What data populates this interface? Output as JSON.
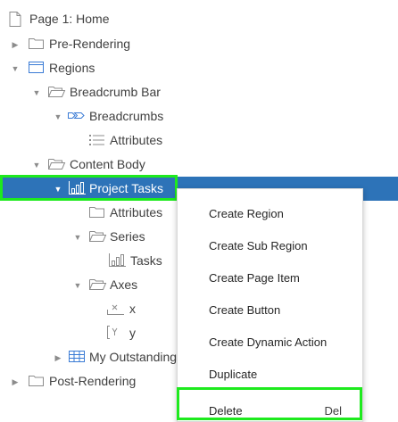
{
  "tree": {
    "page": "Page 1: Home",
    "pre_rendering": "Pre-Rendering",
    "regions": "Regions",
    "breadcrumb_bar": "Breadcrumb Bar",
    "breadcrumbs": "Breadcrumbs",
    "attributes_1": "Attributes",
    "content_body": "Content Body",
    "project_tasks": "Project Tasks",
    "attributes_2": "Attributes",
    "series": "Series",
    "tasks": "Tasks",
    "axes": "Axes",
    "axis_x": "x",
    "axis_y": "y",
    "my_outstanding": "My Outstanding",
    "post_rendering": "Post-Rendering"
  },
  "context_menu": {
    "items": [
      {
        "label": "Create Region",
        "shortcut": ""
      },
      {
        "label": "Create Sub Region",
        "shortcut": ""
      },
      {
        "label": "Create Page Item",
        "shortcut": ""
      },
      {
        "label": "Create Button",
        "shortcut": ""
      },
      {
        "label": "Create Dynamic Action",
        "shortcut": ""
      },
      {
        "label": "Duplicate",
        "shortcut": ""
      },
      {
        "label": "Delete",
        "shortcut": "Del"
      }
    ]
  },
  "colors": {
    "selection": "#2d73b8",
    "highlight_box": "#1eea1e",
    "icon_gray": "#8c8c8c",
    "icon_blue": "#3a7bd5"
  }
}
